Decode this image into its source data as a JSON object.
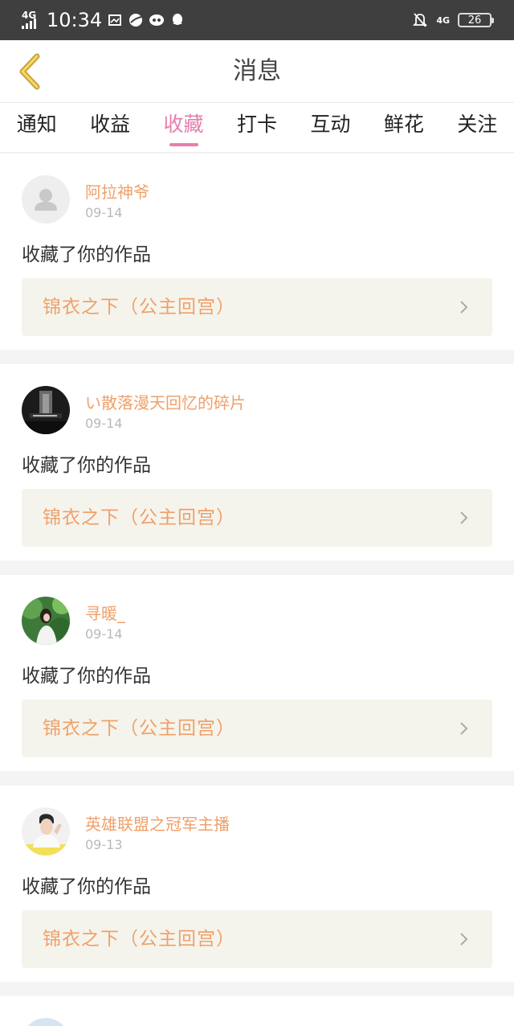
{
  "status_bar": {
    "network_left": "4G",
    "time": "10:34",
    "network_right": "4G",
    "battery": "26"
  },
  "header": {
    "title": "消息"
  },
  "tabs": [
    {
      "label": "通知"
    },
    {
      "label": "收益"
    },
    {
      "label": "收藏"
    },
    {
      "label": "打卡"
    },
    {
      "label": "互动"
    },
    {
      "label": "鲜花"
    },
    {
      "label": "关注"
    }
  ],
  "active_tab": "收藏",
  "messages": [
    {
      "username": "阿拉神爷",
      "date": "09-14",
      "action": "收藏了你的作品",
      "work": "锦衣之下（公主回宫）",
      "avatar": "default-avatar"
    },
    {
      "username": "い散落漫天回忆的碎片",
      "date": "09-14",
      "action": "收藏了你的作品",
      "work": "锦衣之下（公主回宫）",
      "avatar": "dark-photo-avatar"
    },
    {
      "username": "寻暖_",
      "date": "09-14",
      "action": "收藏了你的作品",
      "work": "锦衣之下（公主回宫）",
      "avatar": "green-photo-avatar"
    },
    {
      "username": "英雄联盟之冠军主播",
      "date": "09-13",
      "action": "收藏了你的作品",
      "work": "锦衣之下（公主回宫）",
      "avatar": "person-photo-avatar"
    }
  ],
  "colors": {
    "accent_pink": "#e57fae",
    "accent_orange": "#f0a06a",
    "status_bar_bg": "#3f3f3f",
    "work_box_bg": "#f5f4ec"
  },
  "icons": [
    "back-chevron-icon",
    "chevron-right-icon",
    "notification-muted-icon",
    "qq-icon",
    "browser-icon"
  ]
}
